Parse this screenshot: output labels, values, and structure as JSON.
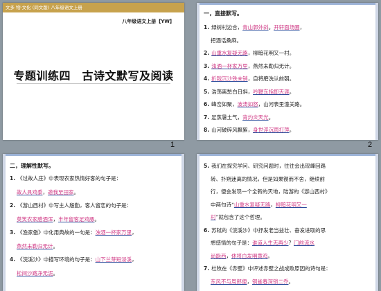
{
  "slide1": {
    "banner": "文多 物·文化 (同文版) 八年级语文上册",
    "grade_label": "八年级语文上册【YW】",
    "title": "专题训练四　古诗文默写及阅读",
    "number": "1"
  },
  "slide2": {
    "heading": "一，直接默写。",
    "number": "2",
    "items": [
      {
        "n": "1.",
        "pre": "绿树村边合，",
        "a1": "青山郭外斜",
        "mid": "。",
        "a2": "开轩面场圃",
        "post": "，"
      },
      {
        "n": "",
        "pre": "把酒话桑麻。"
      },
      {
        "n": "2.",
        "a1": "山重水复疑无路",
        "post": "，柳暗花明又一村。"
      },
      {
        "n": "3.",
        "a1": "浊酒一杯家万里",
        "post": "，燕然未勒归无计。"
      },
      {
        "n": "4.",
        "a1": "折戟沉沙铁未销",
        "post": "，自将磨洗认前朝。"
      },
      {
        "n": "5.",
        "pre": "浩荡离愁白日斜，",
        "a1": "吟鞭东指即天涯",
        "post": "。"
      },
      {
        "n": "6.",
        "pre": "峰峦如聚，",
        "a1": "波涛如怒",
        "post": "，山河表里潼关路。"
      },
      {
        "n": "7.",
        "pre": "足蒸暑土气，",
        "a1": "背灼炎天光",
        "post": "。"
      },
      {
        "n": "8.",
        "pre": "山河破碎风飘絮，",
        "a1": "身世浮沉雨打萍",
        "post": "。"
      }
    ]
  },
  "slide3": {
    "heading": "二，理解性默写。",
    "lines": [
      {
        "n": "1.",
        "pre": "《过故人庄》中表现农家热情好客的句子是："
      },
      {
        "n": "",
        "a1": "故人具鸡黍",
        "mid": "，",
        "a2": "邀我至田家",
        "post": "。"
      },
      {
        "n": "2.",
        "pre": "《游山西村》中写主人殷勤，客人留恋的句子是："
      },
      {
        "n": "",
        "a1": "莫笑农家腊酒浑",
        "mid": "，",
        "a2": "丰年留客足鸡豚",
        "post": "。"
      },
      {
        "n": "3.",
        "pre": "《渔家傲》中化用典故的一句是：",
        "a1": "浊酒一杯家万里",
        "post": "，"
      },
      {
        "n": "",
        "a1": "燕然未勒归无计",
        "post": "。"
      },
      {
        "n": "4.",
        "pre": "《浣溪沙》中描写环境的句子是：",
        "a1": "山下兰芽短浸溪",
        "post": "，"
      },
      {
        "n": "",
        "a1": "松间沙路净无泥",
        "post": "。"
      }
    ]
  },
  "slide4": {
    "lines": [
      {
        "n": "5.",
        "pre": "我们在探究学问、研究问题时，往往会出现峰回路"
      },
      {
        "n": "",
        "pre": "转、扑朔迷离的情况，但是如果锲而不舍，继续前"
      },
      {
        "n": "",
        "pre": "行，便会发现一个全新的天地，陆游的《游山西村》"
      },
      {
        "n": "",
        "pre": "中两句诗“",
        "a1": "山重水复疑无路",
        "mid": "，",
        "a2": "柳暗花明又一"
      },
      {
        "n": "",
        "a1": "村",
        "post": "”就包含了这个哲理。"
      },
      {
        "n": "6.",
        "pre": "苏轼的《浣溪沙》中抒发老当益壮、奋发进取的思"
      },
      {
        "n": "",
        "pre": "想感情的句子是：",
        "a1": "谁道人生无再少",
        "mid": "？",
        "a2": "门前流水"
      },
      {
        "n": "",
        "a1": "尚能西",
        "mid": "，",
        "a2": "休将白发唱黄鸡",
        "post": "。"
      },
      {
        "n": "7.",
        "pre": "杜牧在《赤壁》中评述赤壁之战成败原因的诗句是："
      },
      {
        "n": "",
        "a1": "东风不与周郎便",
        "mid": "，",
        "a2": "铜雀春深锁二乔",
        "post": "。"
      }
    ]
  }
}
